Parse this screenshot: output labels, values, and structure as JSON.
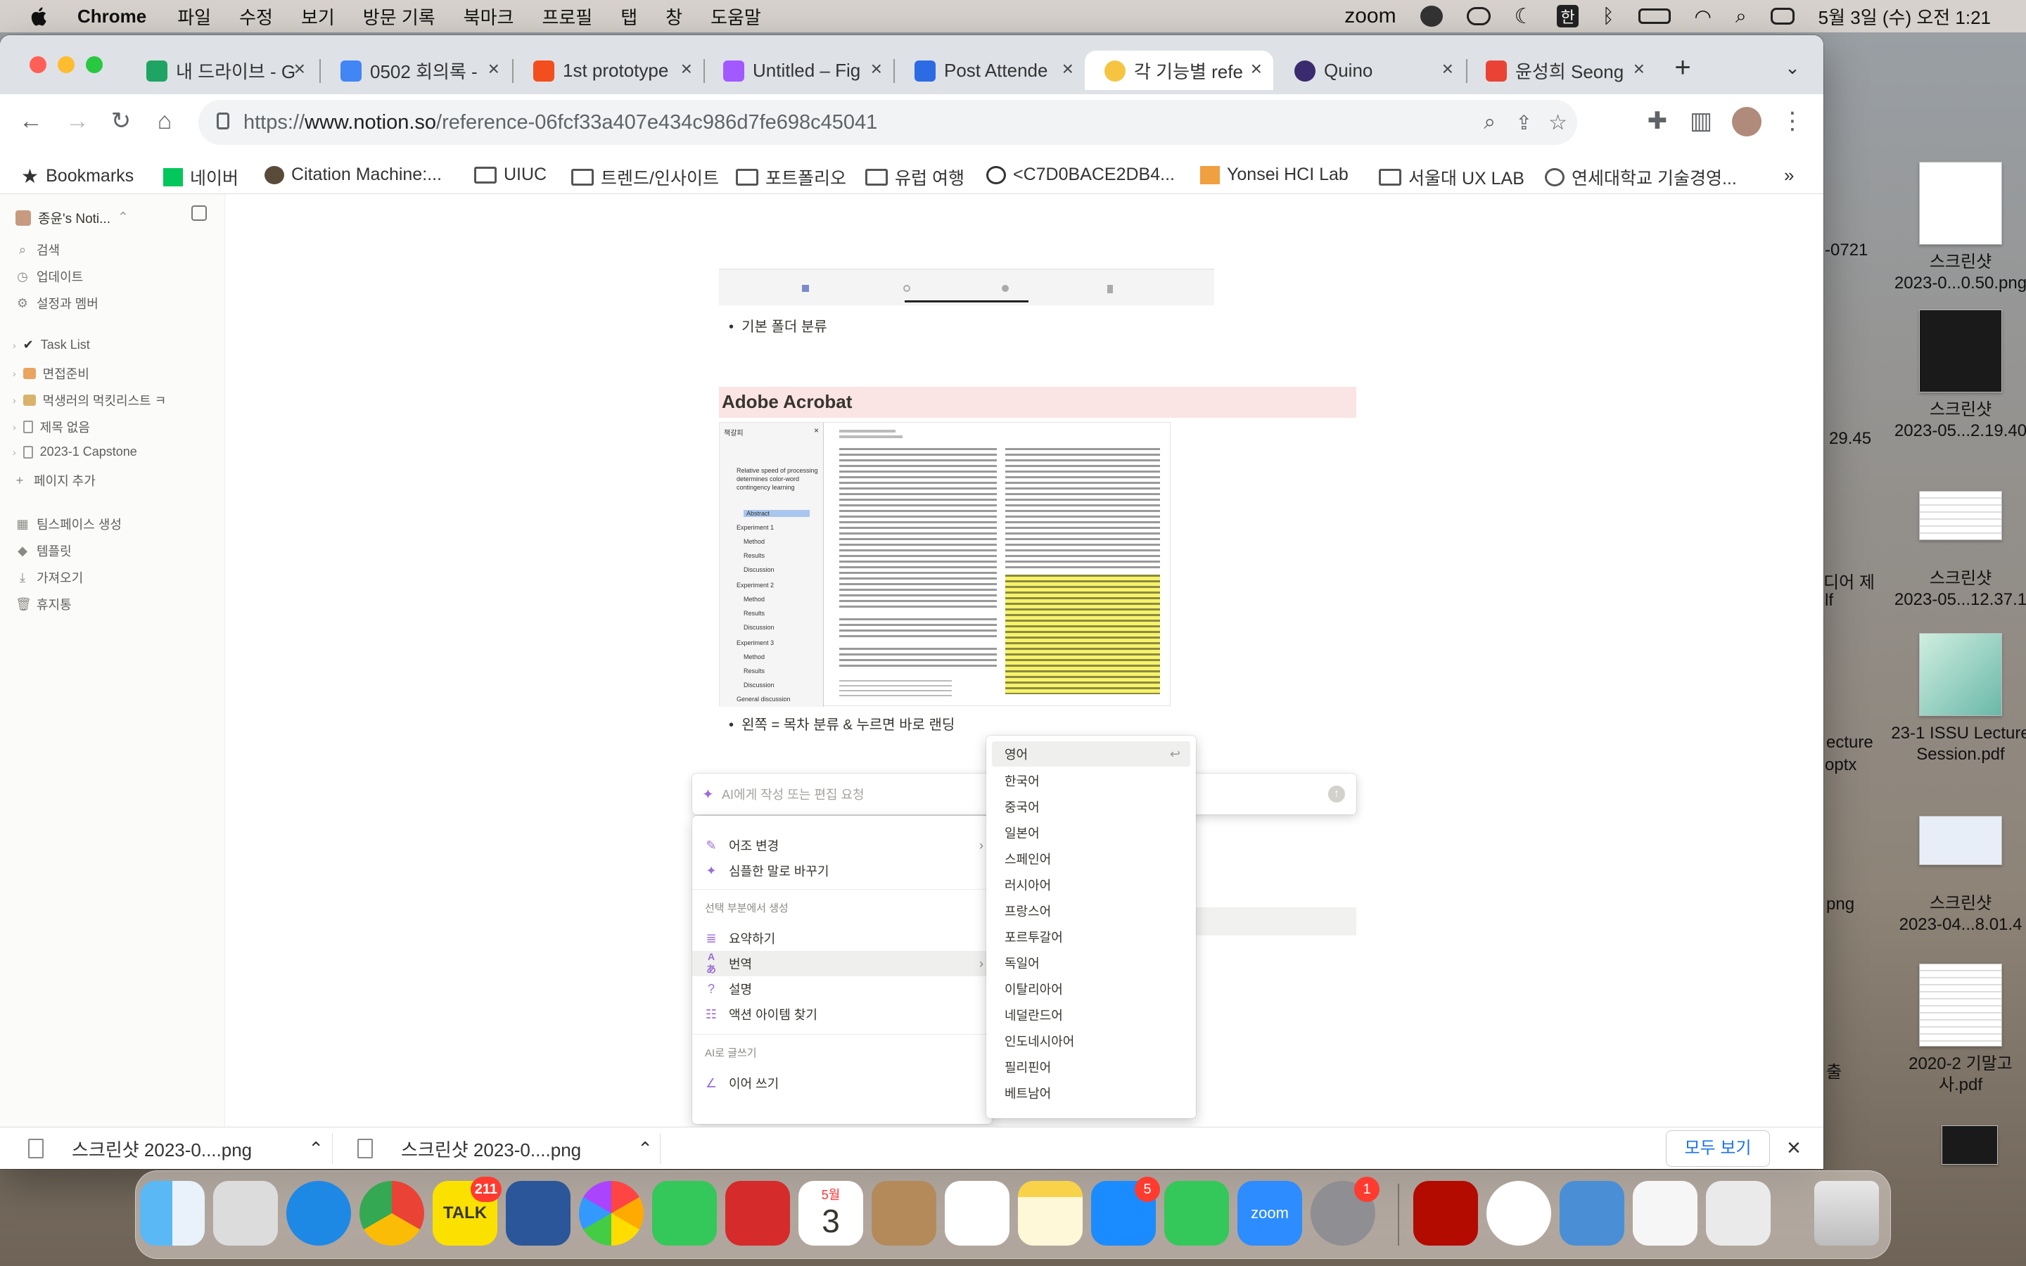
{
  "menubar": {
    "app": "Chrome",
    "items": [
      "파일",
      "수정",
      "보기",
      "방문 기록",
      "북마크",
      "프로필",
      "탭",
      "창",
      "도움말"
    ],
    "zoom": "zoom",
    "ime": "한",
    "clock": "5월 3일 (수) 오전 1:21"
  },
  "tabs": [
    {
      "label": "내 드라이브 - G",
      "color": "#1fa463"
    },
    {
      "label": "0502 회의록 -",
      "color": "#4285f4"
    },
    {
      "label": "1st prototype",
      "color": "#f24e1e"
    },
    {
      "label": "Untitled – Fig",
      "color": "#a259ff"
    },
    {
      "label": "Post Attende",
      "color": "#2d6be4"
    },
    {
      "label": "각 기능별 refe",
      "color": "#f5c542"
    },
    {
      "label": "Quino",
      "color": "#3a2a6e"
    },
    {
      "label": "윤성희 Seong",
      "color": "#ea4335"
    }
  ],
  "url": {
    "scheme": "https://",
    "host": "www.notion.so",
    "path": "/reference-06fcf33a407e434c986d7fe698c45041"
  },
  "bookmarks": [
    "Bookmarks",
    "네이버",
    "Citation Machine:...",
    "UIUC",
    "트렌드/인사이트",
    "포트폴리오",
    "유럽 여행",
    "<C7D0BACE2DB4...",
    "Yonsei HCI Lab",
    "서울대 UX LAB",
    "연세대학교 기술경영..."
  ],
  "sidebar": {
    "workspace": "종윤's Noti...",
    "top": [
      "검색",
      "업데이트",
      "설정과 멤버"
    ],
    "pages": [
      "Task List",
      "면접준비",
      "먹생러의 먹킷리스트 ㅋ",
      "제목 없음",
      "2023-1 Capstone"
    ],
    "add_page": "페이지 추가",
    "bottom": [
      "팀스페이스 생성",
      "템플릿",
      "가져오기",
      "휴지통"
    ]
  },
  "page": {
    "bullet1": "기본 폴더 분류",
    "heading": "Adobe Acrobat",
    "bullet2": "왼쪽 = 목차 분류 & 누르면 바로 랜딩"
  },
  "acrobat": {
    "side_title": "책갈피",
    "toc": [
      "Relative speed of processing determines color-word contingency learning",
      "Abstract",
      "Experiment 1",
      "Method",
      "Results",
      "Discussion",
      "Experiment 2",
      "Method",
      "Results",
      "Discussion",
      "Experiment 3",
      "Method",
      "Results",
      "Discussion",
      "General discussion"
    ]
  },
  "ai": {
    "placeholder": "AI에게 작성 또는 편집 요청",
    "items": [
      "어조 변경",
      "심플한 말로 바꾸기"
    ],
    "head1": "선택 부분에서 생성",
    "gen": [
      "요약하기",
      "번역",
      "설명",
      "액션 아이템 찾기"
    ],
    "head2": "AI로 글쓰기",
    "write": [
      "이어 쓰기"
    ]
  },
  "languages": [
    "영어",
    "한국어",
    "중국어",
    "일본어",
    "스페인어",
    "러시아어",
    "프랑스어",
    "포르투갈어",
    "독일어",
    "이탈리아어",
    "네덜란드어",
    "인도네시아어",
    "필리핀어",
    "베트남어"
  ],
  "downloads": {
    "items": [
      "스크린샷 2023-0....png",
      "스크린샷 2023-0....png"
    ],
    "show_all": "모두 보기"
  },
  "desktop": [
    {
      "name": "스크린샷\n2023-0...0.50.png"
    },
    {
      "name": "스크린샷\n2023-05...2.19.40"
    },
    {
      "name": "스크린샷\n2023-05...12.37.1"
    },
    {
      "name": "23-1 ISSU Lecture\nSession.pdf"
    },
    {
      "name": "스크린샷\n2023-04...8.01.4"
    },
    {
      "name": "2020-2 기말고\n사.pdf"
    }
  ],
  "desktop_partial": [
    "-0721",
    "29.45",
    "디어 제",
    "lf",
    "ecture",
    "optx",
    "png",
    "출"
  ],
  "dock": {
    "talk_badge": "211",
    "calendar_month": "5월",
    "calendar_day": "3",
    "appstore_badge": "5",
    "settings_badge": "1",
    "zoom_label": "zoom",
    "talk_label": "TALK"
  }
}
